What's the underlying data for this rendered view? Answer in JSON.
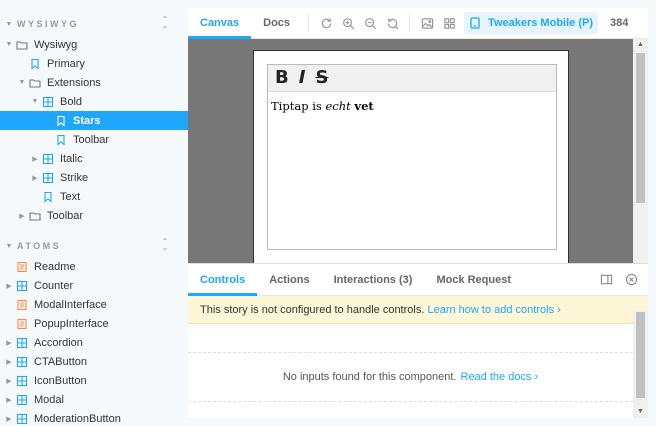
{
  "sidebar": {
    "sections": [
      {
        "title": "WYSIWYG",
        "items": [
          {
            "label": "Wysiwyg",
            "type": "folder",
            "level": 0,
            "caret": "down"
          },
          {
            "label": "Primary",
            "type": "story",
            "level": 1,
            "caret": ""
          },
          {
            "label": "Extensions",
            "type": "folder",
            "level": 1,
            "caret": "down"
          },
          {
            "label": "Bold",
            "type": "component",
            "level": 2,
            "caret": "down"
          },
          {
            "label": "Stars",
            "type": "story",
            "level": 3,
            "caret": "",
            "selected": true
          },
          {
            "label": "Toolbar",
            "type": "story",
            "level": 3,
            "caret": ""
          },
          {
            "label": "Italic",
            "type": "component",
            "level": 2,
            "caret": "right"
          },
          {
            "label": "Strike",
            "type": "component",
            "level": 2,
            "caret": "right"
          },
          {
            "label": "Text",
            "type": "story",
            "level": 2,
            "caret": ""
          },
          {
            "label": "Toolbar",
            "type": "folder",
            "level": 1,
            "caret": "right"
          }
        ]
      },
      {
        "title": "ATOMS",
        "items": [
          {
            "label": "Readme",
            "type": "doc",
            "level": 0,
            "caret": ""
          },
          {
            "label": "Counter",
            "type": "component",
            "level": 0,
            "caret": "right"
          },
          {
            "label": "ModalInterface",
            "type": "doc",
            "level": 0,
            "caret": ""
          },
          {
            "label": "PopupInterface",
            "type": "doc",
            "level": 0,
            "caret": ""
          },
          {
            "label": "Accordion",
            "type": "component",
            "level": 0,
            "caret": "right"
          },
          {
            "label": "CTAButton",
            "type": "component",
            "level": 0,
            "caret": "right"
          },
          {
            "label": "IconButton",
            "type": "component",
            "level": 0,
            "caret": "right"
          },
          {
            "label": "Modal",
            "type": "component",
            "level": 0,
            "caret": "right"
          },
          {
            "label": "ModerationButton",
            "type": "component",
            "level": 0,
            "caret": "right"
          }
        ]
      }
    ]
  },
  "toolbar": {
    "tabs": [
      "Canvas",
      "Docs"
    ],
    "active_tab": "Canvas",
    "tools": [
      "reload-icon",
      "zoom-in-icon",
      "zoom-out-icon",
      "zoom-reset-icon",
      "background-icon",
      "grid-icon"
    ],
    "viewport_label": "Tweakers Mobile (P)",
    "viewport_width": "384"
  },
  "editor": {
    "buttons": [
      "B",
      "I",
      "S"
    ],
    "content_prefix": "Tiptap is ",
    "content_em": "echt",
    "content_space": " ",
    "content_strong": "vet"
  },
  "addons": {
    "tabs": [
      "Controls",
      "Actions",
      "Interactions (3)",
      "Mock Request"
    ],
    "active_tab": "Controls",
    "notice_text": "This story is not configured to handle controls.",
    "notice_link": "Learn how to add controls",
    "empty_text": "No inputs found for this component.",
    "empty_link": "Read the docs"
  },
  "colors": {
    "accent": "#1ea7fd",
    "doc_icon": "#ff8744",
    "component_icon": "#1ea7fd",
    "story_icon": "#1ea7fd",
    "notice_bg": "#fef7d7"
  }
}
